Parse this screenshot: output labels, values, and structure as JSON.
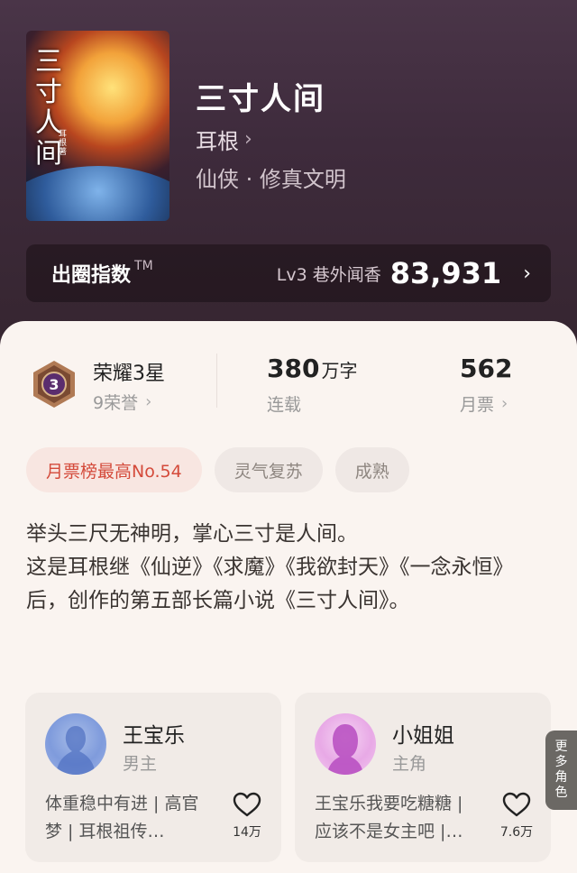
{
  "book": {
    "cover_title": "三寸人间",
    "cover_author": "耳根著",
    "title": "三寸人间",
    "author": "耳根",
    "genre": "仙侠 · 修真文明"
  },
  "index": {
    "label": "出圈指数",
    "tm": "TM",
    "level_text": "Lv3 巷外闻香",
    "score": "83,931"
  },
  "stats": {
    "honor_title": "荣耀3星",
    "honor_sub": "9荣誉",
    "badge_level": "3",
    "words_num": "380",
    "words_unit": "万字",
    "words_label": "连载",
    "ticket_num": "562",
    "ticket_label": "月票"
  },
  "tags": [
    "月票榜最高No.54",
    "灵气复苏",
    "成熟"
  ],
  "synopsis": {
    "line1": "举头三尺无神明，掌心三寸是人间。",
    "line2": "这是耳根继《仙逆》《求魔》《我欲封天》《一念永恒》后，创作的第五部长篇小说《三寸人间》。"
  },
  "roles": [
    {
      "name": "王宝乐",
      "type": "男主",
      "desc": "体重稳中有进 | 高官梦 | 耳根祖传…",
      "likes": "14万"
    },
    {
      "name": "小姐姐",
      "type": "主角",
      "desc": "王宝乐我要吃糖糖 | 应该不是女主吧 |…",
      "likes": "7.6万"
    }
  ],
  "more_roles": "更多角色",
  "colors": {
    "hero_bg": "#3e2b3c",
    "rank_tag": "#d44a3a",
    "card_bg": "#faf4f0"
  }
}
